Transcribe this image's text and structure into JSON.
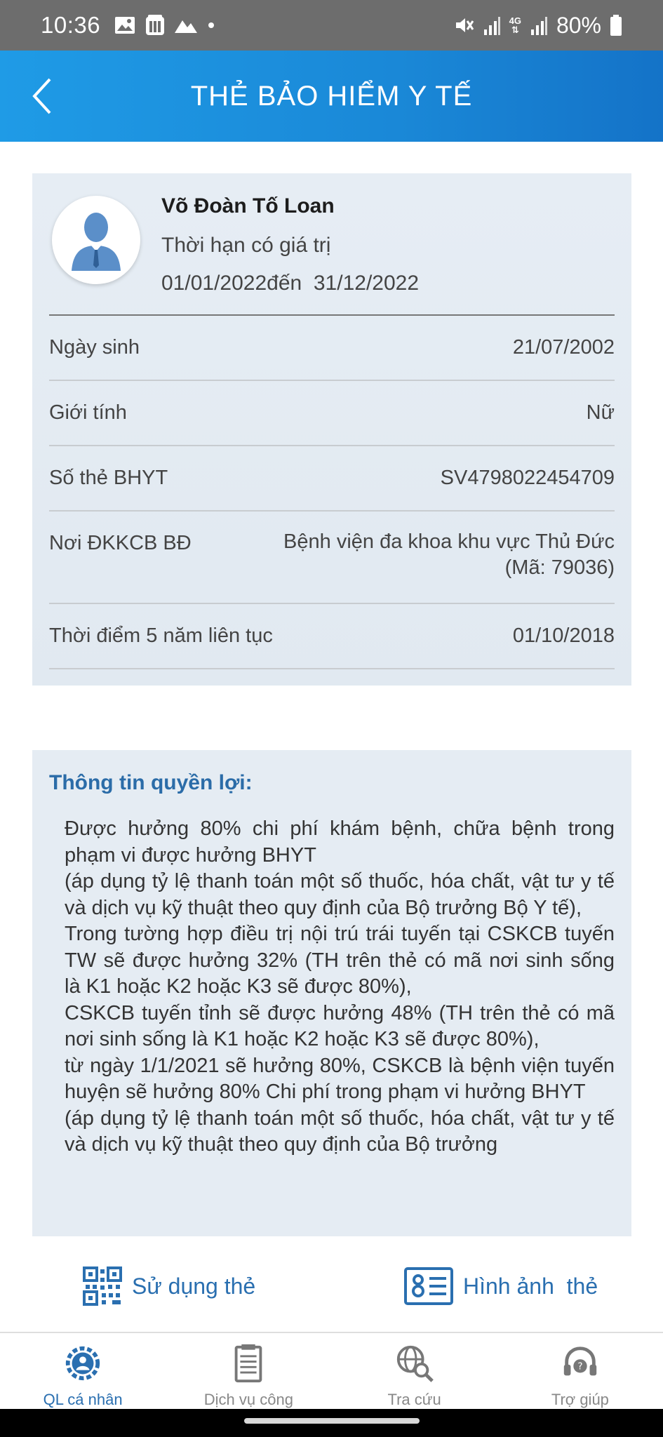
{
  "status_bar": {
    "time": "10:36",
    "battery": "80%",
    "network": "4G",
    "icons": [
      "image-icon",
      "calendar-app-icon",
      "mountain-icon",
      "dot-icon",
      "mute-icon",
      "signal-icon",
      "battery-icon"
    ]
  },
  "header": {
    "title": "THẺ BẢO HIỂM Y TẾ",
    "back_icon": "chevron-left-icon"
  },
  "card": {
    "name": "Võ Đoàn Tố Loan",
    "validity_label": "Thời hạn có giá trị",
    "validity_range": "01/01/2022đến  31/12/2022",
    "rows": [
      {
        "label": "Ngày sinh",
        "value": "21/07/2002"
      },
      {
        "label": "Giới tính",
        "value": "Nữ"
      },
      {
        "label": "Số thẻ BHYT",
        "value": "SV4798022454709"
      },
      {
        "label": "Nơi ĐKKCB BĐ",
        "value": "Bệnh viện đa khoa khu vực Thủ Đức",
        "value_line2": "(Mã: 79036)"
      },
      {
        "label": "Thời điểm 5 năm liên tục",
        "value": "01/10/2018"
      }
    ]
  },
  "benefits": {
    "title": "Thông tin quyền lợi:",
    "paragraphs": [
      "Được hưởng 80% chi phí khám bệnh, chữa bệnh trong phạm vi được hưởng BHYT",
      "(áp dụng tỷ lệ thanh toán một số thuốc, hóa chất, vật tư y tế và dịch vụ kỹ thuật theo quy định của Bộ trưởng Bộ Y tế),",
      "Trong tường hợp điều trị nội trú trái tuyến tại CSKCB tuyến TW sẽ được hưởng 32% (TH trên thẻ có mã nơi sinh sống là K1 hoặc K2 hoặc K3 sẽ được 80%),",
      "CSKCB tuyến tỉnh sẽ được hưởng 48% (TH trên thẻ có mã nơi sinh sống là K1 hoặc K2 hoặc K3 sẽ được 80%),",
      "từ ngày 1/1/2021 sẽ hưởng 80%, CSKCB là bệnh viện tuyến huyện sẽ hưởng 80% Chi phí trong phạm vi hưởng BHYT",
      "(áp dụng tỷ lệ thanh toán một số thuốc, hóa chất, vật tư y tế và dịch vụ kỹ thuật theo quy định của Bộ trưởng"
    ]
  },
  "actions": {
    "use_card": "Sử dụng thẻ",
    "card_image": "Hình ảnh  thẻ"
  },
  "nav": [
    {
      "label": "QL cá nhân",
      "icon": "profile-gear-icon",
      "active": true
    },
    {
      "label": "Dịch vụ công",
      "icon": "document-icon",
      "active": false
    },
    {
      "label": "Tra cứu",
      "icon": "globe-search-icon",
      "active": false
    },
    {
      "label": "Trợ giúp",
      "icon": "headset-help-icon",
      "active": false
    }
  ],
  "colors": {
    "header_blue": "#1a88d7",
    "accent_blue": "#2a6fb0",
    "panel_bg": "#e5ecf3"
  }
}
